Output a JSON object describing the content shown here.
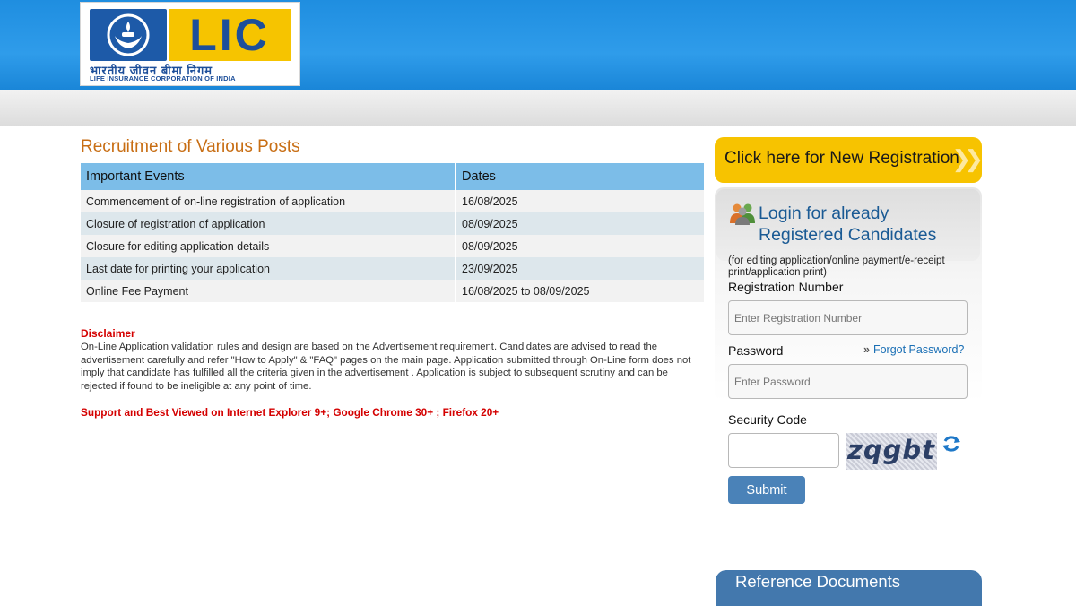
{
  "header": {
    "logo_text": "LIC",
    "logo_hindi": "भारतीय जीवन बीमा निगम",
    "logo_english": "LIFE INSURANCE CORPORATION OF INDIA"
  },
  "main": {
    "title": "Recruitment of Various Posts",
    "table": {
      "headers": [
        "Important Events",
        "Dates"
      ],
      "rows": [
        {
          "event": "Commencement of on-line registration of application",
          "date": "16/08/2025"
        },
        {
          "event": "Closure of registration of application",
          "date": "08/09/2025"
        },
        {
          "event": "Closure for editing application details",
          "date": "08/09/2025"
        },
        {
          "event": "Last date for printing your application",
          "date": "23/09/2025"
        },
        {
          "event": "Online Fee Payment",
          "date": "16/08/2025 to 08/09/2025"
        }
      ]
    },
    "disclaimer_title": "Disclaimer",
    "disclaimer_text": "On-Line Application validation rules and design are based on the Advertisement requirement. Candidates are advised to read the advertisement carefully and refer \"How to Apply\" & \"FAQ\" pages on the main page. Application submitted through On-Line form does not imply that candidate has fulfilled all the criteria given in the advertisement . Application is subject to subsequent scrutiny and can be rejected if found to be ineligible at any point of time.",
    "support_text": "Support and Best Viewed on Internet Explorer 9+; Google Chrome 30+ ; Firefox 20+"
  },
  "sidebar": {
    "new_registration_label": "Click here for New Registration",
    "login_title": "Login for already Registered Candidates",
    "login_note": "(for editing application/online payment/e-receipt print/application print)",
    "registration_label": "Registration Number",
    "registration_placeholder": "Enter Registration Number",
    "password_label": "Password",
    "forgot_password": "Forgot Password?",
    "password_placeholder": "Enter Password",
    "security_label": "Security Code",
    "captcha_text": "zqgbt",
    "submit_label": "Submit",
    "reference_documents": "Reference Documents"
  },
  "icons": {
    "users": "users-group-icon",
    "refresh": "refresh-icon",
    "arrows": "double-chevron-right-icon"
  },
  "colors": {
    "header_blue": "#1f8ee0",
    "title_orange": "#c86e14",
    "table_header": "#7cbde8",
    "accent_yellow": "#f7c300",
    "disclaimer_red": "#d40000",
    "login_blue": "#1a5a94",
    "button_blue": "#4a82b8"
  }
}
